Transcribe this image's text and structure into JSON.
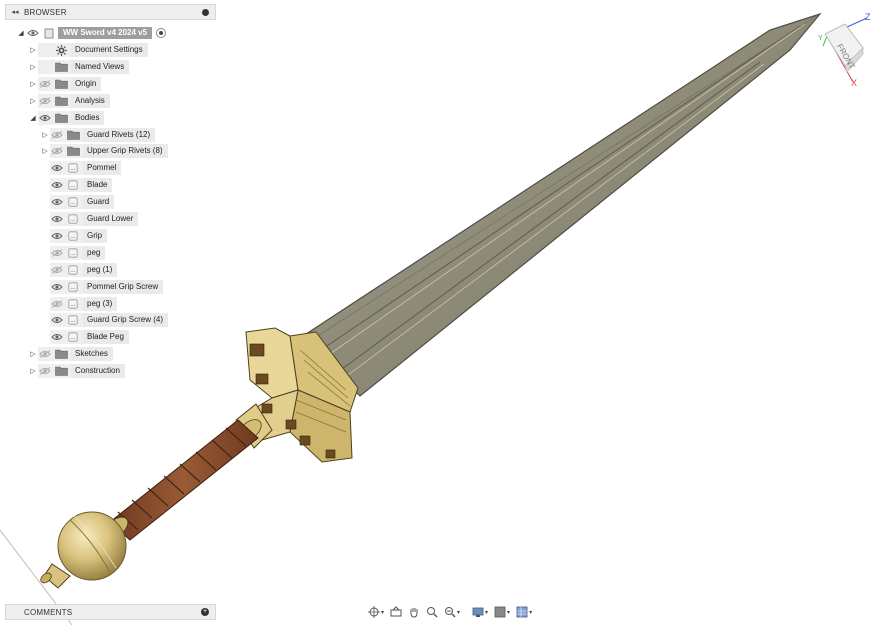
{
  "browser": {
    "title": "BROWSER",
    "collapse_icon": "double-chevron-left-icon",
    "root": {
      "label": "WW Sword v4 2024 v5"
    },
    "items": [
      {
        "label": "Document Settings",
        "icon": "gear-icon",
        "level": 1,
        "expander": true,
        "eye": false
      },
      {
        "label": "Named Views",
        "icon": "folder-icon",
        "level": 1,
        "expander": true,
        "eye": false
      },
      {
        "label": "Origin",
        "icon": "folder-icon",
        "level": 1,
        "expander": true,
        "eye": true,
        "hidden": true
      },
      {
        "label": "Analysis",
        "icon": "folder-icon",
        "level": 1,
        "expander": true,
        "eye": true,
        "hidden": true
      },
      {
        "label": "Bodies",
        "icon": "folder-icon",
        "level": 1,
        "expander": true,
        "expanded": true,
        "eye": true
      },
      {
        "label": "Guard Rivets (12)",
        "icon": "folder-icon",
        "level": 2,
        "expander": true,
        "eye": true,
        "hidden": true
      },
      {
        "label": "Upper Grip Rivets (8)",
        "icon": "folder-icon",
        "level": 2,
        "expander": true,
        "eye": true,
        "hidden": true
      },
      {
        "label": "Pommel",
        "icon": "body-icon",
        "level": 2,
        "eye": true
      },
      {
        "label": "Blade",
        "icon": "body-icon",
        "level": 2,
        "eye": true
      },
      {
        "label": "Guard",
        "icon": "body-icon",
        "level": 2,
        "eye": true
      },
      {
        "label": "Guard Lower",
        "icon": "body-icon",
        "level": 2,
        "eye": true
      },
      {
        "label": "Grip",
        "icon": "body-icon",
        "level": 2,
        "eye": true
      },
      {
        "label": "peg",
        "icon": "body-icon",
        "level": 2,
        "eye": true,
        "hidden": true
      },
      {
        "label": "peg (1)",
        "icon": "body-icon",
        "level": 2,
        "eye": true,
        "hidden": true
      },
      {
        "label": "Pommel Grip Screw",
        "icon": "body-icon",
        "level": 2,
        "eye": true
      },
      {
        "label": "peg (3)",
        "icon": "body-icon",
        "level": 2,
        "eye": true,
        "hidden": true
      },
      {
        "label": "Guard Grip Screw (4)",
        "icon": "body-icon",
        "level": 2,
        "eye": true
      },
      {
        "label": "Blade Peg",
        "icon": "body-icon",
        "level": 2,
        "eye": true
      },
      {
        "label": "Sketches",
        "icon": "folder-icon",
        "level": 1,
        "expander": true,
        "eye": true,
        "hidden": true
      },
      {
        "label": "Construction",
        "icon": "folder-icon",
        "level": 1,
        "expander": true,
        "eye": true,
        "hidden": true
      }
    ]
  },
  "comments": {
    "title": "COMMENTS"
  },
  "viewcube": {
    "face": "FRONT",
    "axis_z": "Z",
    "axis_x": "X",
    "axis_y": "Y"
  },
  "colors": {
    "blade": "#8f8b78",
    "blade_edge": "#5f5c52",
    "brass": "#d8c27a",
    "grip_wood": "#8a4e2e",
    "accent_axis_z": "#3f5fd8",
    "accent_axis_x": "#e04040",
    "accent_axis_y": "#33bb33"
  },
  "navbar": {
    "buttons": [
      "orbit-icon",
      "look-at-icon",
      "pan-icon",
      "zoom-icon",
      "zoom-window-icon",
      "display-settings-icon",
      "visual-style-icon",
      "grid-snap-icon"
    ]
  }
}
